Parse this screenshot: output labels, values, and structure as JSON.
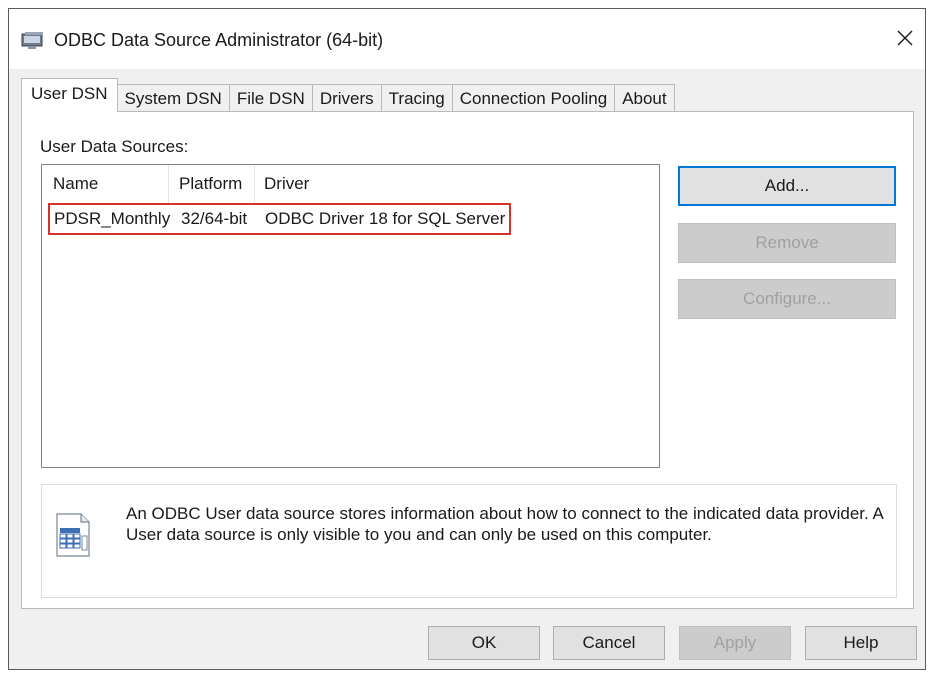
{
  "window": {
    "title": "ODBC Data Source Administrator (64-bit)",
    "close_glyph": "✕"
  },
  "tabs": [
    {
      "label": "User DSN",
      "active": true
    },
    {
      "label": "System DSN"
    },
    {
      "label": "File DSN"
    },
    {
      "label": "Drivers"
    },
    {
      "label": "Tracing"
    },
    {
      "label": "Connection Pooling"
    },
    {
      "label": "About"
    }
  ],
  "user_dsn": {
    "section_label": "User Data Sources:",
    "columns": [
      "Name",
      "Platform",
      "Driver"
    ],
    "rows": [
      {
        "name": "PDSR_Monthly",
        "platform": "32/64-bit",
        "driver": "ODBC Driver 18 for SQL Server",
        "highlighted": true
      }
    ],
    "buttons": {
      "add": "Add...",
      "remove": "Remove",
      "configure": "Configure..."
    },
    "info_text": "An ODBC User data source stores information about how to connect to the indicated data provider.   A User data source is only visible to you and can only be used on this computer."
  },
  "footer": {
    "ok": "OK",
    "cancel": "Cancel",
    "apply": "Apply",
    "help": "Help"
  },
  "colors": {
    "highlight_border": "#d9322e",
    "default_button_border": "#0078d7",
    "dialog_background": "#f0f0f0"
  },
  "icons": {
    "app": "odbc-app-icon",
    "info": "data-source-info-icon",
    "close": "close-icon"
  }
}
